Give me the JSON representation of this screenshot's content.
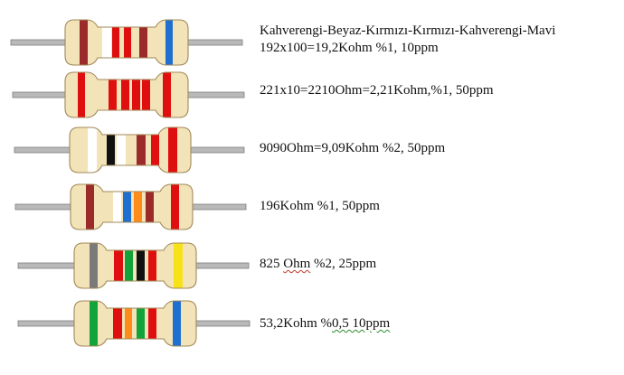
{
  "colors": {
    "body": "#f3e3b8",
    "body_edge": "#a08a5a",
    "lead": "#b9b9b9",
    "lead_edge": "#7d7d7d"
  },
  "resistors": [
    {
      "caption": [
        "Kahverengi-Beyaz-Kırmızı-Kırmızı-Kahverengi-Mavi",
        "192x100=19,2Kohm %1, 10ppm"
      ],
      "bands": [
        "#9b2b2b",
        "#ffffff",
        "#e00f0f",
        "#e00f0f",
        "#9b2b2b",
        "#1f6fd1"
      ]
    },
    {
      "caption": [
        "221x10=2210Ohm=2,21Kohm,%1, 50ppm"
      ],
      "bands": [
        "#e00f0f",
        "#e00f0f",
        "#e00f0f",
        "#e00f0f",
        "#e00f0f",
        "#e00f0f"
      ]
    },
    {
      "caption": [
        "9090Ohm=9,09Kohm %2, 50ppm"
      ],
      "bands": [
        "#ffffff",
        "#111111",
        "#ffffff",
        "#9b2b2b",
        "#e00f0f",
        "#e00f0f"
      ]
    },
    {
      "caption": [
        "196Kohm %1, 50ppm"
      ],
      "bands": [
        "#9b2b2b",
        "#ffffff",
        "#1f6fd1",
        "#ff8c1a",
        "#9b2b2b",
        "#e00f0f"
      ]
    },
    {
      "caption": [
        "825 Ohm %2, 25ppm"
      ],
      "bands": [
        "#7a7a7a",
        "#e00f0f",
        "#12a33a",
        "#111111",
        "#e00f0f",
        "#f7e21a"
      ]
    },
    {
      "caption": [
        "53,2Kohm %0,5  10ppm"
      ],
      "bands": [
        "#12a33a",
        "#e00f0f",
        "#ff8c1a",
        "#12a33a",
        "#e00f0f",
        "#1f6fd1"
      ]
    }
  ]
}
